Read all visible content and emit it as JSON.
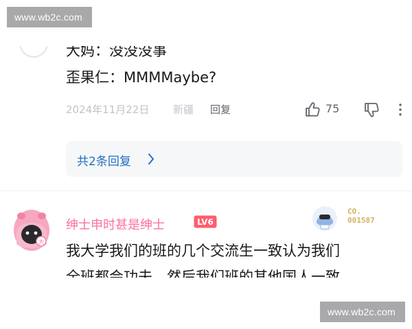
{
  "watermark": {
    "text": "www.wb2c.com"
  },
  "comment_top": {
    "line1": "大妈：没没没事",
    "line2": "歪果仁：MMMMaybe?",
    "date": "2024年11月22日",
    "location": "新疆",
    "reply_label": "回复",
    "like_count": "75",
    "replies_link": "共2条回复"
  },
  "comment_next": {
    "username": "绅士申时甚是绅士",
    "level": "LV6",
    "badge_lines": [
      "CO.",
      "001587"
    ],
    "body_line1": "我大学我们的班的几个交流生一致认为我们",
    "body_line2": "全班都会功夫，然后我们班的其他国人一致"
  },
  "colors": {
    "accent_blue": "#1f6fc5",
    "username_pink": "#fb7299",
    "level_red": "#ff5d6e",
    "badge_gold": "#d5b360",
    "meta_grey": "#9499a0"
  },
  "icons": [
    "thumbs-up-icon",
    "thumbs-down-icon",
    "more-vertical-icon",
    "chevron-right-icon"
  ]
}
